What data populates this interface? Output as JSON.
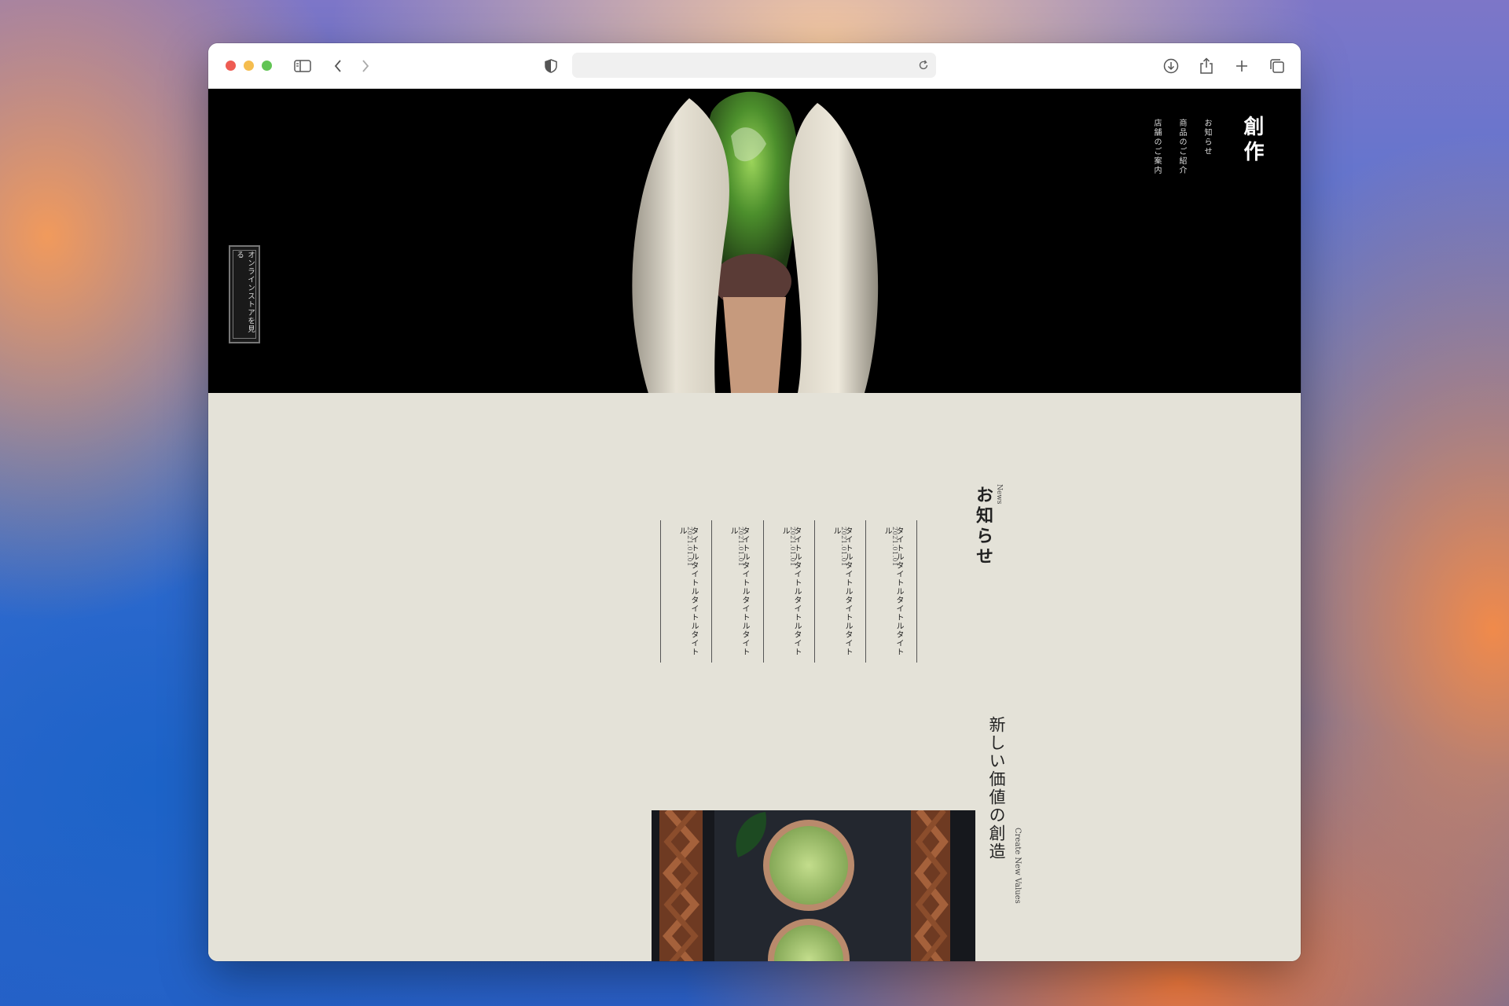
{
  "browser": {
    "url": "",
    "buttons": {
      "sidebar": "sidebar-icon",
      "back": "chevron-left-icon",
      "forward": "chevron-right-icon",
      "shield": "shield-icon",
      "reload": "reload-icon",
      "download": "download-icon",
      "share": "share-icon",
      "new_tab": "plus-icon",
      "tabs": "tabs-icon"
    }
  },
  "site": {
    "logo": "創作",
    "nav": [
      {
        "label": "お知らせ"
      },
      {
        "label": "商品のご紹介"
      },
      {
        "label": "店舗のご案内"
      }
    ],
    "store_button": "オンラインストアを見る",
    "news": {
      "label_en": "News",
      "title": "お知らせ",
      "items": [
        {
          "date": "2021.01.01",
          "title": "タイトルタイトルタイトルタイトル"
        },
        {
          "date": "2021.01.01",
          "title": "タイトルタイトルタイトルタイトル"
        },
        {
          "date": "2021.01.01",
          "title": "タイトルタイトルタイトルタイトル"
        },
        {
          "date": "2021.01.01",
          "title": "タイトルタイトルタイトルタイトル"
        },
        {
          "date": "2021.01.01",
          "title": "タイトルタイトルタイトルタイトル"
        }
      ]
    },
    "value": {
      "title": "新しい価値の創造",
      "label_en": "Create New Values"
    }
  },
  "colors": {
    "page_bg": "#e4e2d8",
    "hero_bg": "#000000",
    "text": "#222222"
  }
}
